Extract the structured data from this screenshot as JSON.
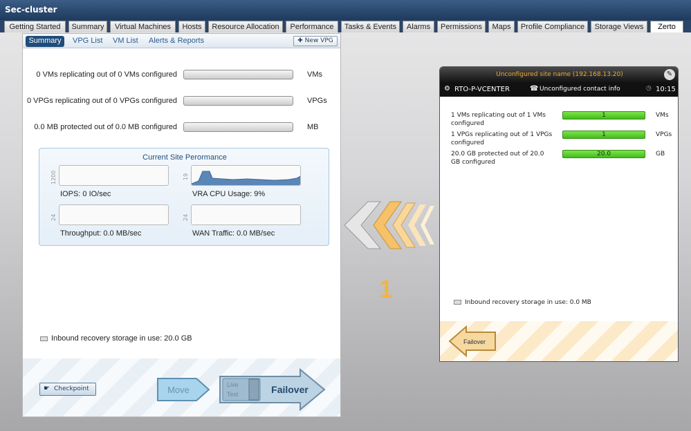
{
  "window": {
    "title": "Sec-cluster"
  },
  "tabs": [
    {
      "label": "Getting Started"
    },
    {
      "label": "Summary"
    },
    {
      "label": "Virtual Machines"
    },
    {
      "label": "Hosts"
    },
    {
      "label": "Resource Allocation"
    },
    {
      "label": "Performance"
    },
    {
      "label": "Tasks & Events"
    },
    {
      "label": "Alarms"
    },
    {
      "label": "Permissions"
    },
    {
      "label": "Maps"
    },
    {
      "label": "Profile Compliance"
    },
    {
      "label": "Storage Views"
    },
    {
      "label": "Zerto"
    }
  ],
  "active_tab": "Zerto",
  "subtabs": {
    "summary": "Summary",
    "vpg_list": "VPG List",
    "vm_list": "VM List",
    "alerts": "Alerts & Reports",
    "new_vpg": "New VPG"
  },
  "local": {
    "vms_text": "0 VMs replicating out of 0 VMs configured",
    "vms_unit": "VMs",
    "vpgs_text": "0 VPGs replicating out of 0 VPGs configured",
    "vpgs_unit": "VPGs",
    "mb_text": "0.0 MB protected out of 0.0 MB configured",
    "mb_unit": "MB",
    "perf_title": "Current Site Perormance",
    "iops_axis": "1200",
    "iops": "IOPS: 0 IO/sec",
    "cpu_axis": "19",
    "cpu": "VRA CPU Usage: 9%",
    "throughput_axis": "24",
    "throughput": "Throughput: 0.0 MB/sec",
    "wan_axis": "24",
    "wan": "WAN Traffic:  0.0 MB/sec",
    "storage": "Inbound recovery storage in use: 20.0 GB",
    "checkpoint": "Checkpoint",
    "move": "Move",
    "live": "Live",
    "test": "Test",
    "failover": "Failover"
  },
  "remote": {
    "site_name": "Unconfigured site name (192.168.13.20)",
    "vcenter": "RTO-P-VCENTER",
    "contact": "Unconfigured contact info",
    "time": "10:15",
    "vms_text": "1 VMs replicating out of 1 VMs configured",
    "vms_value": "1",
    "vms_unit": "VMs",
    "vpgs_text": "1 VPGs replicating out of 1 VPGs configured",
    "vpgs_value": "1",
    "vpgs_unit": "VPGs",
    "gb_text": "20.0 GB protected out of 20.0 GB configured",
    "gb_value": "20.0",
    "gb_unit": "GB",
    "storage": "Inbound recovery storage in use: 0.0 MB",
    "failover": "Failover"
  },
  "direction_count": "1",
  "colors": {
    "title_bar": "#1f3a5e",
    "accent_blue": "#1f4d7a",
    "progress_green": "#3fbf19",
    "arrow_orange": "#f2b441"
  }
}
